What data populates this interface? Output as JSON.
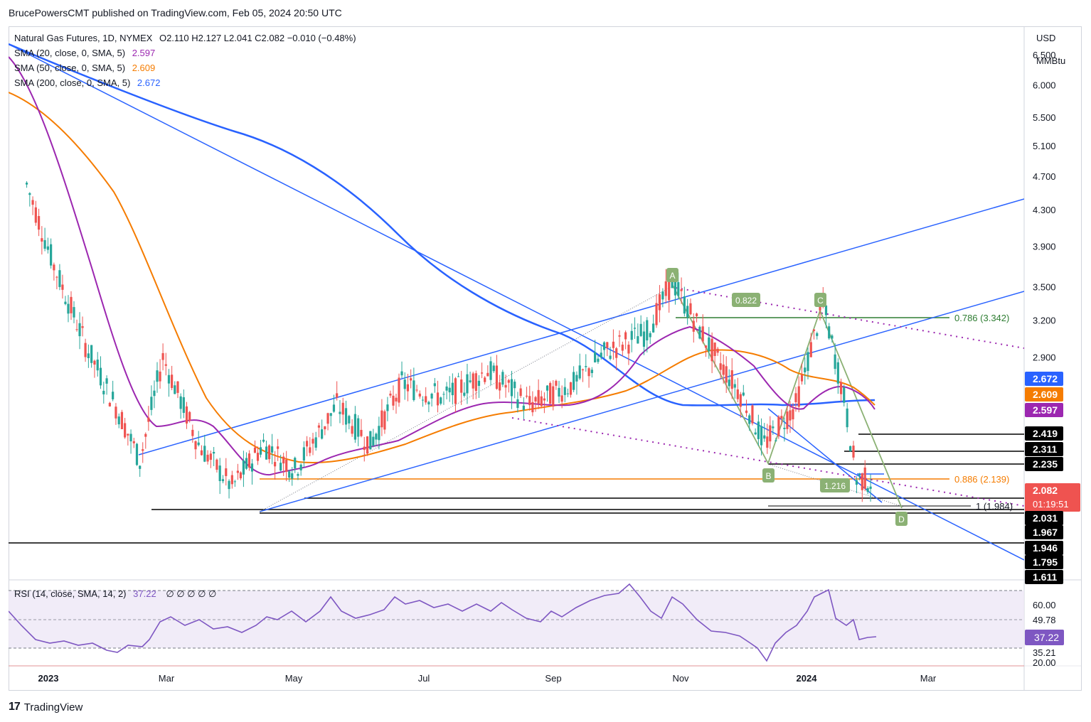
{
  "header": {
    "published": "BrucePowersCMT published on TradingView.com, Feb 05, 2024 20:50 UTC"
  },
  "legend": {
    "instrument": "Natural Gas Futures, 1D, NYMEX",
    "ohlc": "O2.110  H2.127  L2.041  C2.082  −0.010 (−0.48%)",
    "sma20_label": "SMA (20, close, 0, SMA, 5)",
    "sma20_value": "2.597",
    "sma50_label": "SMA (50, close, 0, SMA, 5)",
    "sma50_value": "2.609",
    "sma200_label": "SMA (200, close, 0, SMA, 5)",
    "sma200_value": "2.672",
    "rsi_label": "RSI (14, close, SMA, 14, 2)",
    "rsi_value": "37.22",
    "rsi_extras": "∅  ∅         ∅  ∅  ∅"
  },
  "price_axis": {
    "currency": "USD",
    "unit": "MMBtu",
    "ticks": [
      "6.500",
      "6.000",
      "5.500",
      "5.100",
      "4.700",
      "4.300",
      "3.900",
      "3.500",
      "3.200",
      "2.900"
    ]
  },
  "price_badges": [
    {
      "value": "2.672",
      "color": "#2962ff"
    },
    {
      "value": "2.609",
      "color": "#f57c00"
    },
    {
      "value": "2.597",
      "color": "#9c27b0"
    },
    {
      "value": "2.419",
      "color": "#000000"
    },
    {
      "value": "2.311",
      "color": "#000000"
    },
    {
      "value": "2.235",
      "color": "#000000"
    },
    {
      "value": "2.082",
      "color": "#ef5350"
    },
    {
      "value": "2.031",
      "color": "#000000"
    },
    {
      "value": "1.967",
      "color": "#000000"
    },
    {
      "value": "1.946",
      "color": "#000000"
    },
    {
      "value": "1.795",
      "color": "#000000"
    },
    {
      "value": "1.611",
      "color": "#000000"
    }
  ],
  "countdown": "01:19:51",
  "rsi_axis": {
    "ticks": [
      "60.00",
      "49.78",
      "35.21",
      "20.00"
    ],
    "badge": "37.22"
  },
  "time_axis": [
    "2023",
    "Mar",
    "May",
    "Jul",
    "Sep",
    "Nov",
    "2024",
    "Mar"
  ],
  "annotations": {
    "fib_786": "0.786 (3.342)",
    "fib_886": "0.886 (2.139)",
    "fib_1": "1 (1.984)",
    "ratio_822": "0.822",
    "ratio_1216": "1.216",
    "point_a": "A",
    "point_b": "B",
    "point_c": "C",
    "point_d": "D"
  },
  "colors": {
    "sma20": "#9c27b0",
    "sma50": "#f57c00",
    "sma200": "#2962ff",
    "trendline": "#2962ff",
    "pattern": "#8bb174",
    "up_candle": "#26a69a",
    "down_candle": "#ef5350",
    "rsi": "#7e57c2"
  },
  "chart_data": {
    "type": "candlestick",
    "title": "Natural Gas Futures, 1D, NYMEX",
    "y_scale": "log",
    "ylim": [
      1.6,
      7.0
    ],
    "last": {
      "open": 2.11,
      "high": 2.127,
      "low": 2.041,
      "close": 2.082
    },
    "approx_path": [
      {
        "date": "2022-12-28",
        "price": 4.6
      },
      {
        "date": "2023-01-10",
        "price": 3.7
      },
      {
        "date": "2023-01-25",
        "price": 3.0
      },
      {
        "date": "2023-02-10",
        "price": 2.5
      },
      {
        "date": "2023-02-20",
        "price": 2.2
      },
      {
        "date": "2023-03-03",
        "price": 2.9
      },
      {
        "date": "2023-03-20",
        "price": 2.3
      },
      {
        "date": "2023-04-05",
        "price": 2.05
      },
      {
        "date": "2023-04-20",
        "price": 2.3
      },
      {
        "date": "2023-05-05",
        "price": 2.15
      },
      {
        "date": "2023-05-25",
        "price": 2.55
      },
      {
        "date": "2023-06-10",
        "price": 2.3
      },
      {
        "date": "2023-06-25",
        "price": 2.7
      },
      {
        "date": "2023-07-15",
        "price": 2.6
      },
      {
        "date": "2023-08-05",
        "price": 2.8
      },
      {
        "date": "2023-08-25",
        "price": 2.55
      },
      {
        "date": "2023-09-15",
        "price": 2.7
      },
      {
        "date": "2023-10-01",
        "price": 2.95
      },
      {
        "date": "2023-10-20",
        "price": 3.1
      },
      {
        "date": "2023-11-01",
        "price": 3.55
      },
      {
        "date": "2023-11-20",
        "price": 2.95
      },
      {
        "date": "2023-12-05",
        "price": 2.6
      },
      {
        "date": "2023-12-15",
        "price": 2.3
      },
      {
        "date": "2023-12-30",
        "price": 2.55
      },
      {
        "date": "2024-01-12",
        "price": 3.35
      },
      {
        "date": "2024-01-22",
        "price": 2.6
      },
      {
        "date": "2024-01-28",
        "price": 2.1
      },
      {
        "date": "2024-02-05",
        "price": 2.082
      }
    ],
    "sma": [
      {
        "name": "SMA (20, close, 0, SMA, 5)",
        "last": 2.597
      },
      {
        "name": "SMA (50, close, 0, SMA, 5)",
        "last": 2.609
      },
      {
        "name": "SMA (200, close, 0, SMA, 5)",
        "last": 2.672
      }
    ],
    "horizontal_levels": [
      3.342,
      2.419,
      2.311,
      2.235,
      2.139,
      2.031,
      1.984,
      1.967,
      1.946
    ],
    "rsi": {
      "name": "RSI (14, close, SMA, 14, 2)",
      "last": 37.22,
      "levels": [
        60.0,
        49.78,
        35.21,
        20.0
      ]
    },
    "xlabels": [
      "2023",
      "Mar",
      "May",
      "Jul",
      "Sep",
      "Nov",
      "2024",
      "Mar"
    ]
  }
}
